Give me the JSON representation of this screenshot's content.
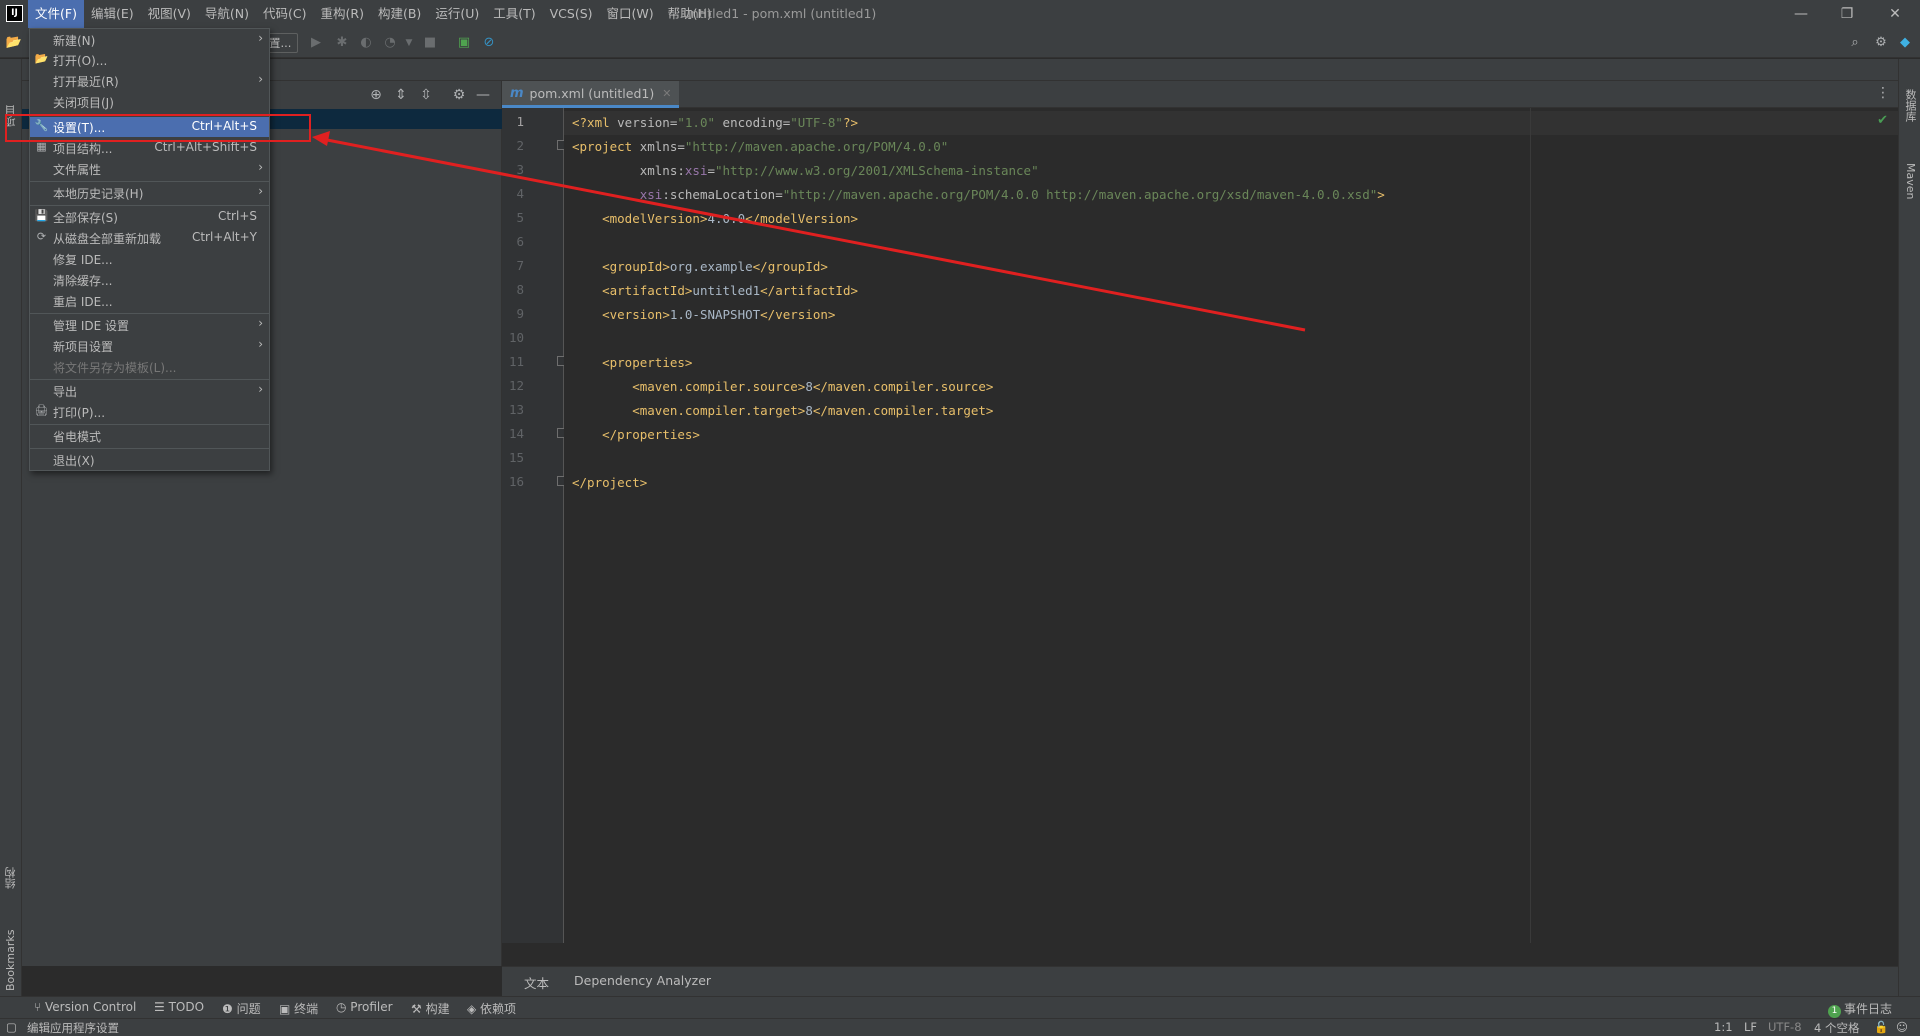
{
  "app": {
    "logo_text": "IJ",
    "window_title": "untitled1 - pom.xml (untitled1)"
  },
  "menubar": [
    {
      "label": "文件(F)",
      "active": true
    },
    {
      "label": "编辑(E)"
    },
    {
      "label": "视图(V)"
    },
    {
      "label": "导航(N)"
    },
    {
      "label": "代码(C)"
    },
    {
      "label": "重构(R)"
    },
    {
      "label": "构建(B)"
    },
    {
      "label": "运行(U)"
    },
    {
      "label": "工具(T)"
    },
    {
      "label": "VCS(S)"
    },
    {
      "label": "窗口(W)"
    },
    {
      "label": "帮助(H)"
    }
  ],
  "window_controls": {
    "minimize": "—",
    "restore": "❐",
    "close": "✕"
  },
  "toolbar": {
    "run_config_label": "置..."
  },
  "left_strip": {
    "project_tab": "项目",
    "structure_tab": "结构",
    "bookmarks_tab": "Bookmarks"
  },
  "right_strip": {
    "database_tab": "数据库",
    "maven_tab": "Maven"
  },
  "file_menu": {
    "items": [
      {
        "label": "新建(N)",
        "submenu": true
      },
      {
        "label": "打开(O)...",
        "icon": "folder-open-icon"
      },
      {
        "label": "打开最近(R)",
        "submenu": true
      },
      {
        "label": "关闭项目(J)"
      },
      {
        "label": "设置(T)...",
        "shortcut": "Ctrl+Alt+S",
        "icon": "wrench-icon",
        "highlighted": true
      },
      {
        "label": "项目结构...",
        "shortcut": "Ctrl+Alt+Shift+S",
        "icon": "project-structure-icon"
      },
      {
        "label": "文件属性",
        "submenu": true
      },
      {
        "label": "本地历史记录(H)",
        "submenu": true
      },
      {
        "label": "全部保存(S)",
        "shortcut": "Ctrl+S",
        "icon": "save-icon"
      },
      {
        "label": "从磁盘全部重新加载",
        "shortcut": "Ctrl+Alt+Y",
        "icon": "reload-icon"
      },
      {
        "label": "修复 IDE..."
      },
      {
        "label": "清除缓存..."
      },
      {
        "label": "重启 IDE..."
      },
      {
        "label": "管理 IDE 设置",
        "submenu": true
      },
      {
        "label": "新项目设置",
        "submenu": true
      },
      {
        "label": "将文件另存为模板(L)...",
        "disabled": true
      },
      {
        "label": "导出",
        "submenu": true
      },
      {
        "label": "打印(P)...",
        "icon": "print-icon"
      },
      {
        "label": "省电模式"
      },
      {
        "label": "退出(X)"
      }
    ]
  },
  "editor": {
    "tab_icon": "m",
    "tab_label": "pom.xml (untitled1)",
    "line_numbers": [
      "1",
      "2",
      "3",
      "4",
      "5",
      "6",
      "7",
      "8",
      "9",
      "10",
      "11",
      "12",
      "13",
      "14",
      "15",
      "16"
    ],
    "bottom_tabs": [
      "文本",
      "Dependency Analyzer"
    ]
  },
  "code": {
    "l1": {
      "a": "<?xml ",
      "b": "version",
      "c": "=",
      "d": "\"1.0\"",
      "e": " encoding",
      "f": "=",
      "g": "\"UTF-8\"",
      "h": "?>"
    },
    "l2": {
      "a": "<project ",
      "b": "xmlns",
      "c": "=",
      "d": "\"http://maven.apache.org/POM/4.0.0\""
    },
    "l3": {
      "indent": "         ",
      "a": "xmlns:",
      "b": "xsi",
      "c": "=",
      "d": "\"http://www.w3.org/2001/XMLSchema-instance\""
    },
    "l4": {
      "indent": "         ",
      "a": "xsi",
      "b": ":schemaLocation",
      "c": "=",
      "d": "\"http://maven.apache.org/POM/4.0.0 http://maven.apache.org/xsd/maven-4.0.0.xsd\"",
      "e": ">"
    },
    "l5": {
      "indent": "    ",
      "a": "<modelVersion>",
      "b": "4.0.0",
      "c": "</modelVersion>"
    },
    "l7": {
      "indent": "    ",
      "a": "<groupId>",
      "b": "org.example",
      "c": "</groupId>"
    },
    "l8": {
      "indent": "    ",
      "a": "<artifactId>",
      "b": "untitled1",
      "c": "</artifactId>"
    },
    "l9": {
      "indent": "    ",
      "a": "<version>",
      "b": "1.0-SNAPSHOT",
      "c": "</version>"
    },
    "l11": {
      "indent": "    ",
      "a": "<properties>"
    },
    "l12": {
      "indent": "        ",
      "a": "<maven.compiler.source>",
      "b": "8",
      "c": "</maven.compiler.source>"
    },
    "l13": {
      "indent": "        ",
      "a": "<maven.compiler.target>",
      "b": "8",
      "c": "</maven.compiler.target>"
    },
    "l14": {
      "indent": "    ",
      "a": "</properties>"
    },
    "l16": {
      "a": "</project>"
    }
  },
  "tool_windows": [
    {
      "label": "Version Control",
      "icon": "vcs-icon"
    },
    {
      "label": "TODO",
      "icon": "list-icon"
    },
    {
      "label": "问题",
      "icon": "info-icon"
    },
    {
      "label": "终端",
      "icon": "terminal-icon"
    },
    {
      "label": "Profiler",
      "icon": "profiler-icon"
    },
    {
      "label": "构建",
      "icon": "hammer-icon"
    },
    {
      "label": "依赖项",
      "icon": "layers-icon"
    }
  ],
  "event_log": {
    "label": "事件日志",
    "count": "1"
  },
  "status": {
    "message": "编辑应用程序设置",
    "position": "1:1",
    "line_sep": "LF",
    "encoding": "UTF-8",
    "indent": "4 个空格"
  },
  "colors": {
    "accent": "#4b6eaf",
    "annotation": "#e02020",
    "tab_underline": "#4a88c7"
  }
}
